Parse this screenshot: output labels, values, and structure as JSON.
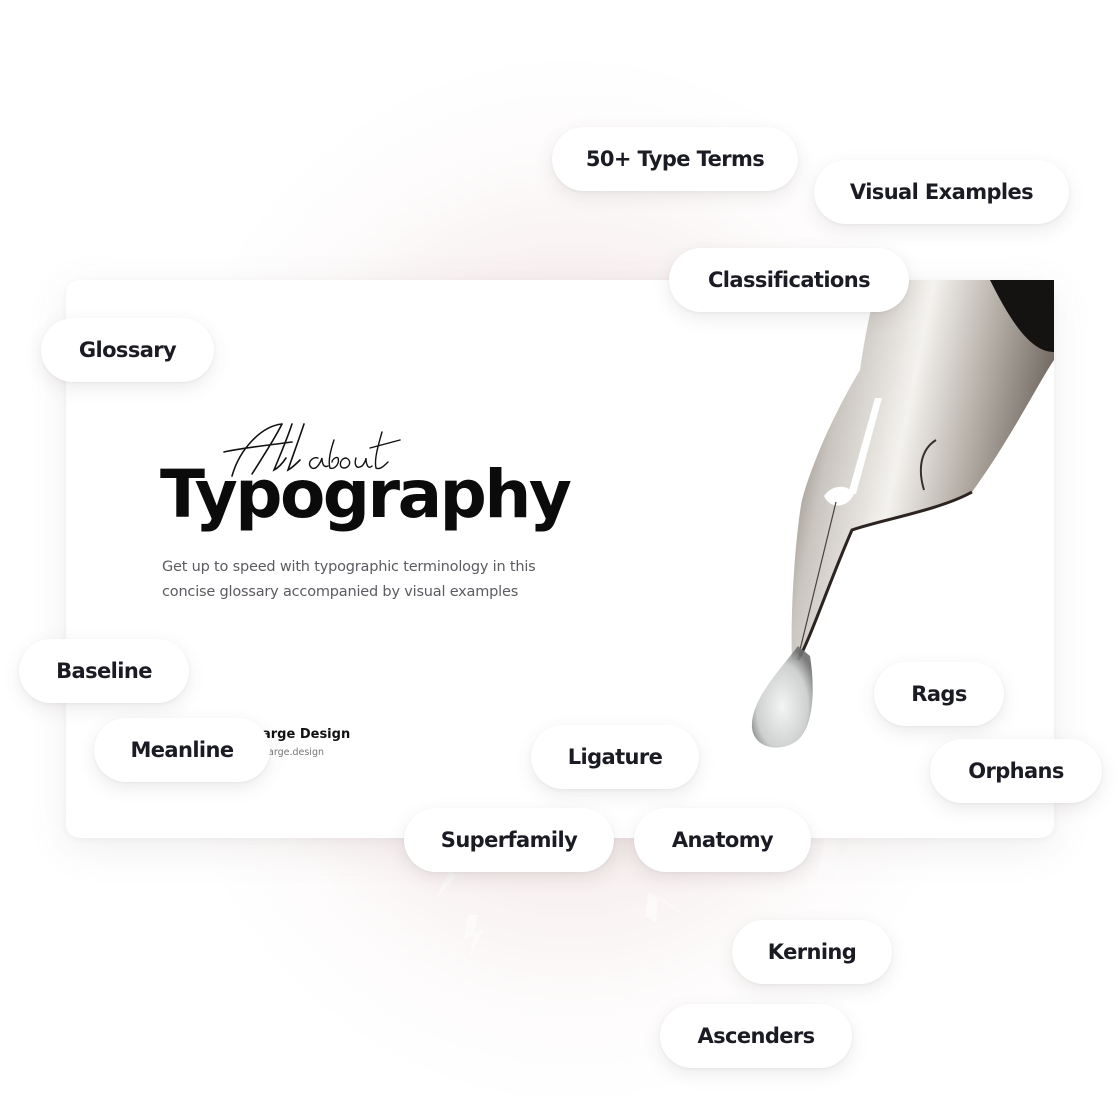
{
  "hero": {
    "script_line": "All about",
    "title": "Typography",
    "subtitle_line1": "Get up to speed with typographic terminology in this",
    "subtitle_line2": "concise glossary accompanied by visual examples",
    "brand_name_partial": "arge Design",
    "brand_url_partial": "harge.design"
  },
  "image": {
    "subject": "fountain-pen-nib-with-ink-drop"
  },
  "colors": {
    "text_dark": "#1b1b24",
    "title": "#0b0b0b",
    "subtitle": "#5b5b62",
    "pill_bg": "#ffffff",
    "glow": "#ecd6d6"
  },
  "tags": [
    {
      "id": "type-terms",
      "label": "50+ Type Terms"
    },
    {
      "id": "visual-examples",
      "label": "Visual Examples"
    },
    {
      "id": "classifications",
      "label": "Classifications"
    },
    {
      "id": "glossary",
      "label": "Glossary"
    },
    {
      "id": "baseline",
      "label": "Baseline"
    },
    {
      "id": "meanline",
      "label": "Meanline"
    },
    {
      "id": "ligature",
      "label": "Ligature"
    },
    {
      "id": "rags",
      "label": "Rags"
    },
    {
      "id": "orphans",
      "label": "Orphans"
    },
    {
      "id": "superfamily",
      "label": "Superfamily"
    },
    {
      "id": "anatomy",
      "label": "Anatomy"
    },
    {
      "id": "kerning",
      "label": "Kerning"
    },
    {
      "id": "ascenders",
      "label": "Ascenders"
    }
  ]
}
